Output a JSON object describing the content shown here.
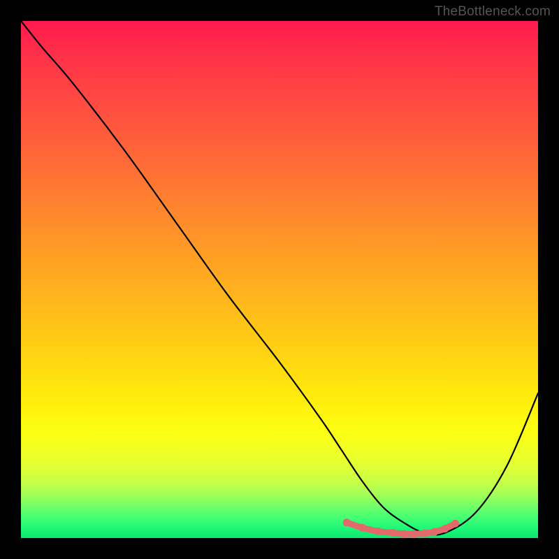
{
  "watermark": "TheBottleneck.com",
  "chart_data": {
    "type": "line",
    "title": "",
    "xlabel": "",
    "ylabel": "",
    "xlim": [
      0,
      100
    ],
    "ylim": [
      0,
      100
    ],
    "series": [
      {
        "name": "bottleneck-curve",
        "x": [
          0,
          4,
          10,
          20,
          30,
          40,
          50,
          58,
          62,
          66,
          70,
          74,
          78,
          82,
          88,
          94,
          100
        ],
        "values": [
          100,
          95,
          88,
          75,
          61,
          47,
          34,
          23,
          17,
          11,
          6,
          3,
          1,
          1,
          5,
          14,
          28
        ]
      }
    ],
    "highlight": {
      "name": "minimum-region",
      "x": [
        63,
        66,
        69,
        72,
        74,
        76,
        78,
        80,
        82,
        84
      ],
      "values": [
        3,
        2,
        1.3,
        1,
        0.8,
        0.8,
        0.9,
        1.2,
        1.8,
        2.8
      ],
      "color": "#e26a6a"
    },
    "colors": {
      "curve": "#000000",
      "highlight": "#e26a6a",
      "gradient_top": "#ff1a4d",
      "gradient_bottom": "#0ae86e",
      "frame": "#000000"
    }
  }
}
